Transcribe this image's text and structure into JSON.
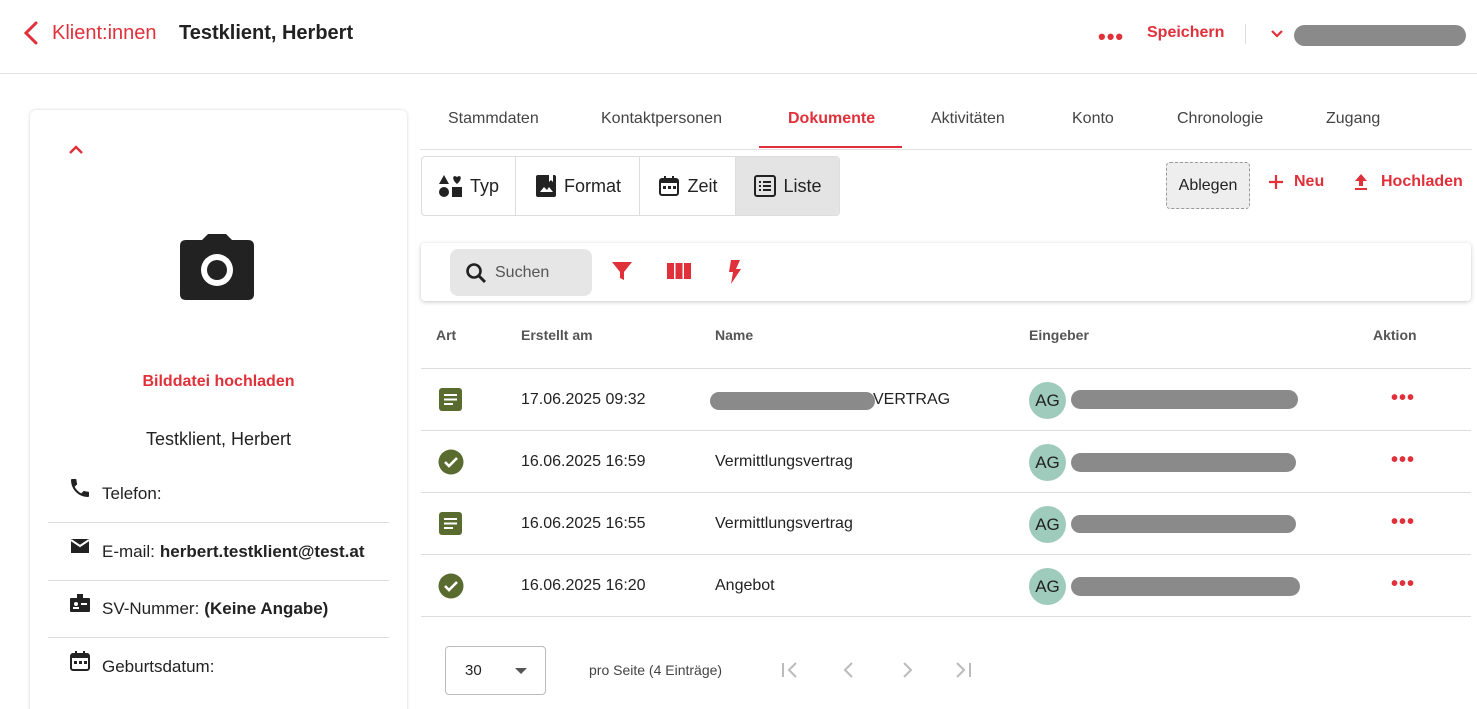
{
  "header": {
    "back_label": "Klient:innen",
    "client_name": "Testklient, Herbert",
    "more": "•••",
    "save_label": "Speichern"
  },
  "left": {
    "upload_label": "Bilddatei hochladen",
    "name": "Testklient, Herbert",
    "info": [
      {
        "icon": "phone-icon",
        "label": "Telefon:",
        "value": ""
      },
      {
        "icon": "mail-icon",
        "label": "E-mail:",
        "value": "herbert.testklient@test.at"
      },
      {
        "icon": "badge-icon",
        "label": "SV-Nummer:",
        "value": "(Keine Angabe)"
      },
      {
        "icon": "calendar-icon",
        "label": "Geburtsdatum:",
        "value": ""
      }
    ]
  },
  "tabs": [
    {
      "label": "Stammdaten"
    },
    {
      "label": "Kontaktpersonen"
    },
    {
      "label": "Dokumente",
      "active": true
    },
    {
      "label": "Aktivitäten"
    },
    {
      "label": "Konto"
    },
    {
      "label": "Chronologie"
    },
    {
      "label": "Zugang"
    }
  ],
  "views": {
    "typ": "Typ",
    "format": "Format",
    "zeit": "Zeit",
    "liste": "Liste",
    "active": "Liste"
  },
  "actions": {
    "ablegen": "Ablegen",
    "neu": "Neu",
    "hochladen": "Hochladen"
  },
  "search": {
    "placeholder": "Suchen"
  },
  "table": {
    "headers": {
      "art": "Art",
      "created": "Erstellt am",
      "name": "Name",
      "eingeber": "Eingeber",
      "aktion": "Aktion"
    },
    "rows": [
      {
        "type": "document-icon",
        "created": "17.06.2025 09:32",
        "name": "VERTRAG",
        "initials": "AG",
        "more": "•••"
      },
      {
        "type": "check-circle-icon",
        "created": "16.06.2025 16:59",
        "name": "Vermittlungsvertrag",
        "initials": "AG",
        "more": "•••"
      },
      {
        "type": "document-icon",
        "created": "16.06.2025 16:55",
        "name": "Vermittlungsvertrag",
        "initials": "AG",
        "more": "•••"
      },
      {
        "type": "check-circle-icon",
        "created": "16.06.2025 16:20",
        "name": "Angebot",
        "initials": "AG",
        "more": "•••"
      }
    ]
  },
  "pagination": {
    "page_size": "30",
    "per_page_label": "pro Seite (4 Einträge)"
  },
  "colors": {
    "accent": "#e0303a",
    "doc_icon": "#5a6b2f",
    "avatar": "#9fcbbd"
  }
}
